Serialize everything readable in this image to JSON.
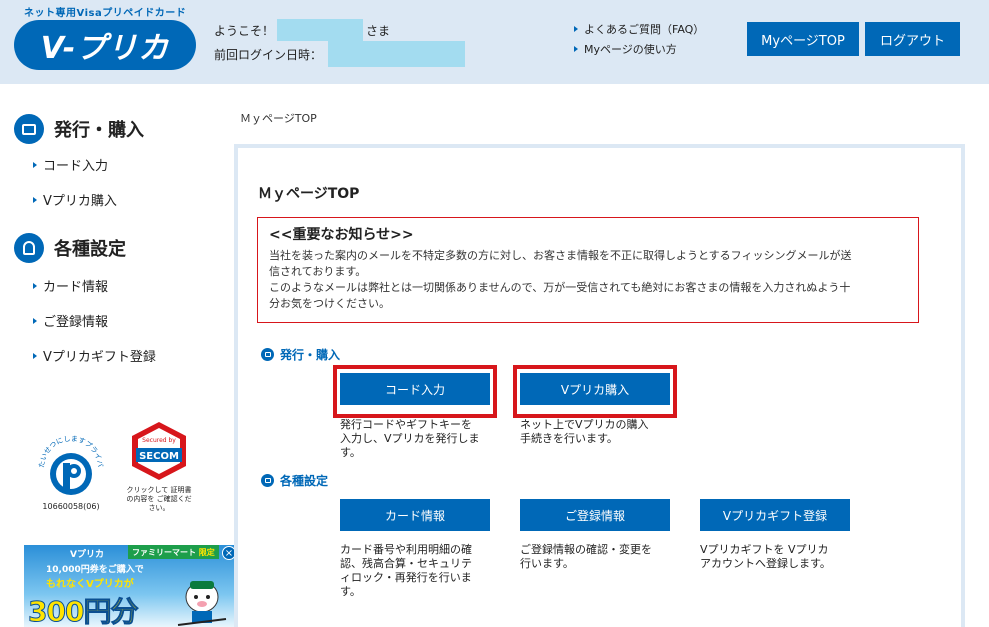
{
  "header": {
    "tagline": "ネット専用Visaプリペイドカード",
    "logo_text": "V-プリカ",
    "welcome_prefix": "ようこそ！",
    "welcome_suffix": "さま",
    "last_login_label": "前回ログイン日時：",
    "help_links": [
      "よくあるご質問（FAQ）",
      "Myページの使い方"
    ],
    "mypage_top_label": "MyページTOP",
    "logout_label": "ログアウト"
  },
  "sidebar": {
    "sections": [
      {
        "title": "発行・購入",
        "icon": "card-icon",
        "items": [
          "コード入力",
          "Vプリカ購入"
        ]
      },
      {
        "title": "各種設定",
        "icon": "lock-icon",
        "items": [
          "カード情報",
          "ご登録情報",
          "Vプリカギフト登録"
        ]
      }
    ],
    "privacy_mark": {
      "arc_text": "たいせつにしますプライバシー",
      "number": "10660058(06)"
    },
    "secom_seal": {
      "badge_top": "Secured by",
      "badge_brand": "SECOM",
      "caption": "クリックして 証明書の内容を ご確認ください。"
    },
    "banner": {
      "brand": "Vプリカ",
      "store": "ファミリーマート",
      "store_tag": "限定",
      "line1": "10,000円券をご購入で",
      "line2": "もれなくVプリカが",
      "amount": "300円分"
    }
  },
  "main": {
    "breadcrumb": "ＭｙページTOP",
    "title": "ＭｙページTOP",
    "notice": {
      "title": "<<重要なお知らせ>>",
      "lines": [
        "当社を装った案内のメールを不特定多数の方に対し、お客さま情報を不正に取得しようとするフィッシングメールが送",
        "信されております。",
        "このようなメールは弊社とは一切関係ありませんので、万が一受信されても絶対にお客さまの情報を入力されぬよう十",
        "分お気をつけください。"
      ]
    },
    "sections": [
      {
        "title": "発行・購入",
        "actions": [
          {
            "label": "コード入力",
            "desc": [
              "発行コードやギフトキーを",
              "入力し、Vプリカを発行しま",
              "す。"
            ]
          },
          {
            "label": "Vプリカ購入",
            "desc": [
              "ネット上でVプリカの購入",
              "手続きを行います。"
            ]
          }
        ]
      },
      {
        "title": "各種設定",
        "actions": [
          {
            "label": "カード情報",
            "desc": [
              "カード番号や利用明細の確",
              "認、残高合算・セキュリテ",
              "ィロック・再発行を行いま",
              "す。"
            ]
          },
          {
            "label": "ご登録情報",
            "desc": [
              "ご登録情報の確認・変更を",
              "行います。"
            ]
          },
          {
            "label": "Vプリカギフト登録",
            "desc": [
              "Vプリカギフトを Vプリカ",
              "アカウントへ登録します。"
            ]
          }
        ]
      }
    ]
  },
  "colors": {
    "brand_blue": "#0068b7",
    "header_bg": "#dce8f4",
    "alert_red": "#d7161b",
    "mask_cyan": "#a3dcf0"
  }
}
